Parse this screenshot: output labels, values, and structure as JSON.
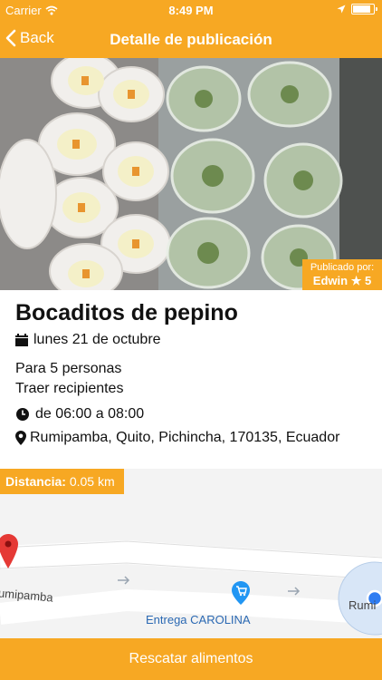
{
  "status": {
    "carrier": "Carrier",
    "time": "8:49 PM"
  },
  "nav": {
    "back_label": "Back",
    "title": "Detalle de publicación"
  },
  "publisher": {
    "label": "Publicado por:",
    "name": "Edwin",
    "rating": "5"
  },
  "post": {
    "title": "Bocaditos de pepino",
    "date": "lunes 21 de octubre",
    "people": "Para 5 personas",
    "note": "Traer recipientes",
    "time": "de 06:00 a 08:00",
    "address": "Rumipamba, Quito, Pichincha, 170135, Ecuador"
  },
  "distance": {
    "label": "Distancia:",
    "value": "0.05 km"
  },
  "map": {
    "street_left": "umipamba",
    "place": "Entrega CAROLINA",
    "street_right": "Rumi"
  },
  "action": {
    "label": "Rescatar alimentos"
  },
  "colors": {
    "accent": "#f7a823",
    "marker": "#e53935",
    "store_pin": "#2196f3"
  }
}
